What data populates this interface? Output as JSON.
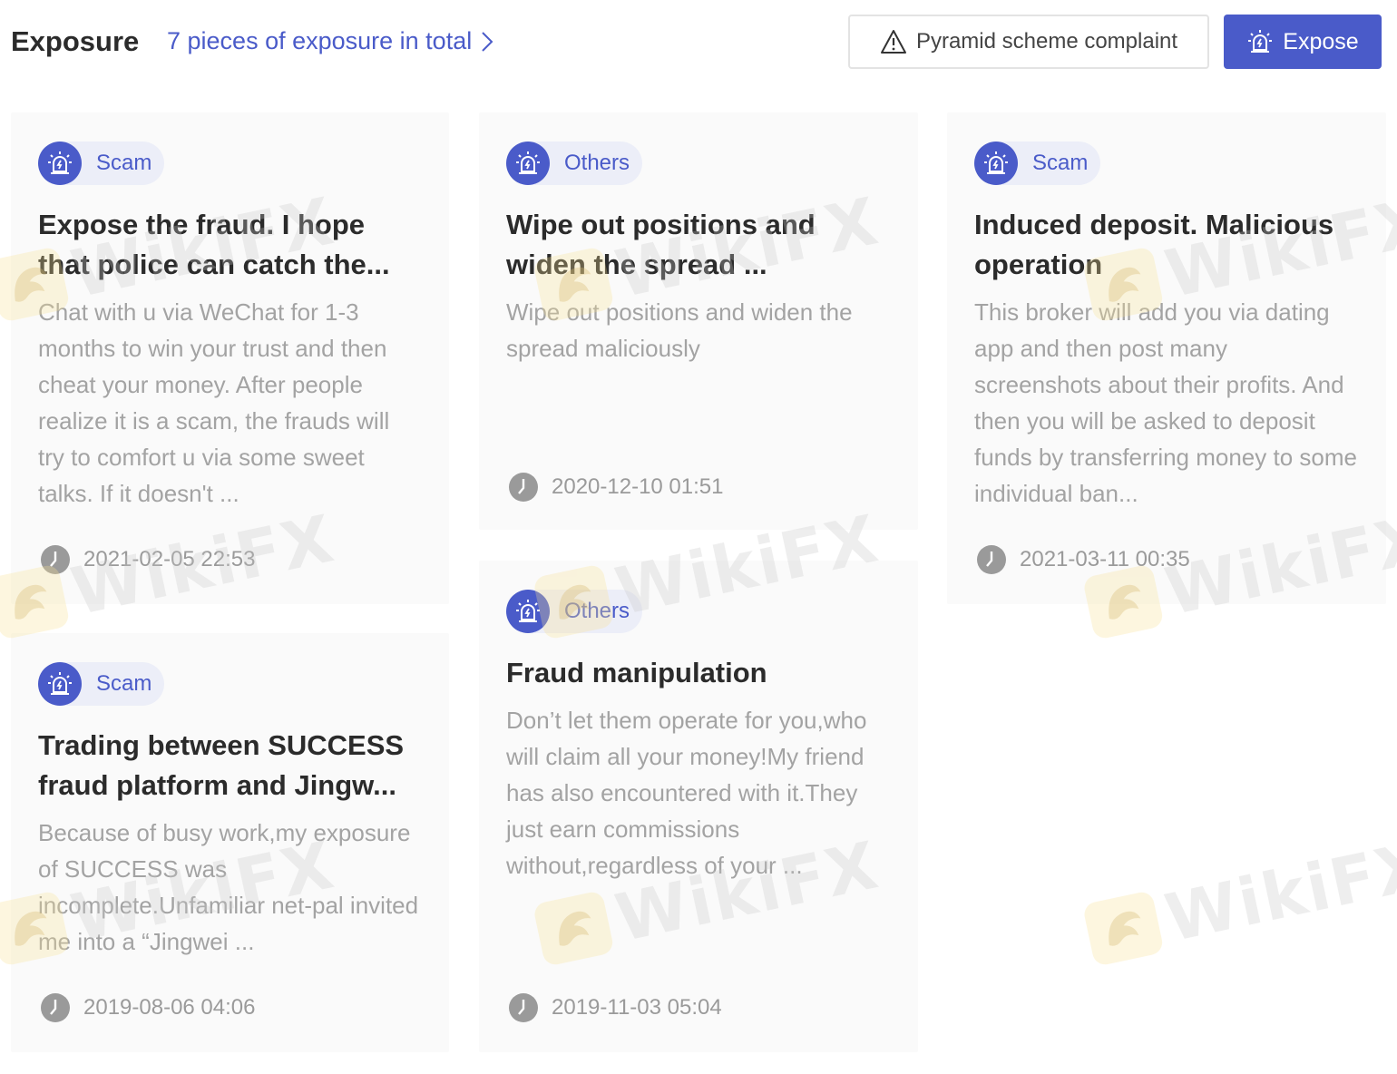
{
  "header": {
    "title": "Exposure",
    "total_link": "7 pieces of exposure in total",
    "complaint_button": "Pyramid scheme complaint",
    "expose_button": "Expose"
  },
  "colors": {
    "accent": "#4a5bc9",
    "tag_bg": "#eceef8",
    "card_bg": "#fafafa",
    "muted_text": "#a3a3a3"
  },
  "watermark_text": "WikiFX",
  "cards": [
    {
      "tag": "Scam",
      "title": "Expose the fraud. I hope that police can catch the...",
      "desc": "Chat with u via WeChat for 1-3 months to win your trust and then cheat your money. After people realize it is a scam, the frauds will try to comfort u via some sweet talks. If it doesn't ...",
      "time": "2021-02-05 22:53"
    },
    {
      "tag": "Others",
      "title": "Wipe out positions and widen the spread ...",
      "desc": "Wipe out positions and widen the spread maliciously",
      "time": "2020-12-10 01:51"
    },
    {
      "tag": "Scam",
      "title": "Induced deposit. Malicious operation",
      "desc": "This broker will add you via dating app and then post many screenshots about their profits. And then you will be asked to deposit funds by transferring money to some individual ban...",
      "time": "2021-03-11 00:35"
    },
    {
      "tag": "Others",
      "title": "Fraud manipulation",
      "desc": "Don’t let them operate for you,who will claim all your money!My friend has also encountered with it.They just earn commissions without,regardless of your ...",
      "time": "2019-11-03 05:04"
    },
    {
      "tag": "Scam",
      "title": "Trading between SUCCESS fraud platform and Jingw...",
      "desc": "Because of busy work,my exposure of  SUCCESS was incomplete.Unfamiliar net-pal  invited me into a “Jingwei ...",
      "time": "2019-08-06 04:06"
    }
  ]
}
